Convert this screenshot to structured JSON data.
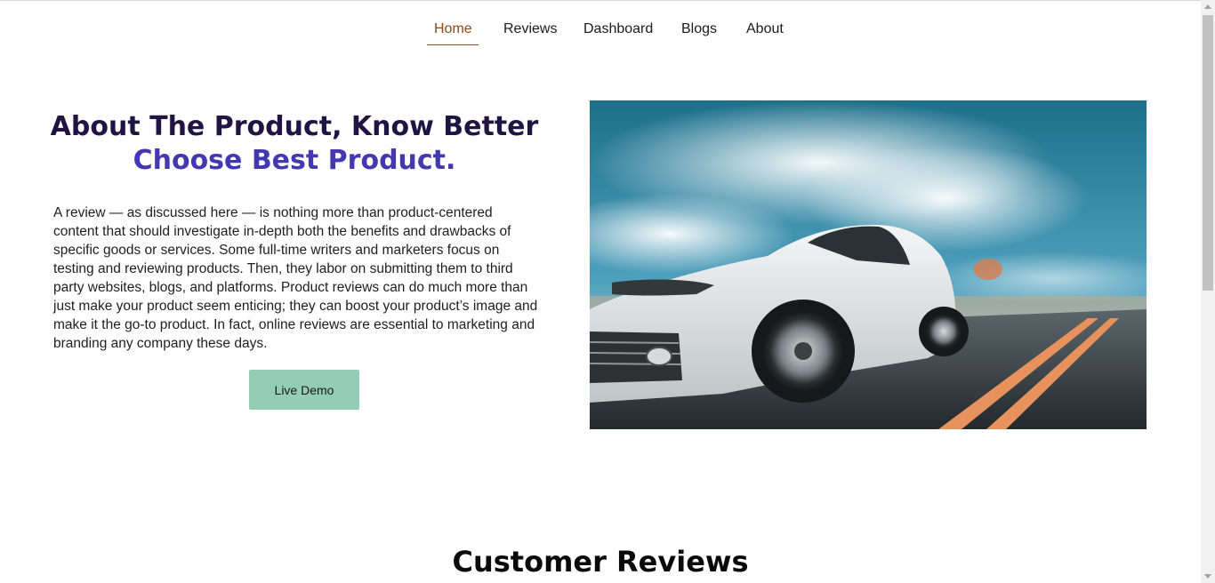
{
  "nav": {
    "items": [
      {
        "label": "Home",
        "active": true
      },
      {
        "label": "Reviews"
      },
      {
        "label": "Dashboard"
      },
      {
        "label": "Blogs"
      },
      {
        "label": "About"
      }
    ]
  },
  "hero": {
    "title_line1": "About The Product, Know Better",
    "title_line2": "Choose Best Product.",
    "description": "A review — as discussed here — is nothing more than product-centered content that should investigate in-depth both the benefits and drawbacks of specific goods or services. Some full-time writers and marketers focus on testing and reviewing products. Then, they labor on submitting them to third party websites, blogs, and platforms. Product reviews can do much more than just make your product seem enticing; they can boost your product’s image and make it the go-to product. In fact, online reviews are essential to marketing and branding any company these days.",
    "button_label": "Live Demo",
    "image": "white sports car on highway"
  },
  "reviews": {
    "title": "Customer Reviews"
  },
  "colors": {
    "nav_active": "#8b4a16",
    "title_dark": "#1f1543",
    "title_accent": "#4338b0",
    "button_bg": "#93cdb6"
  }
}
